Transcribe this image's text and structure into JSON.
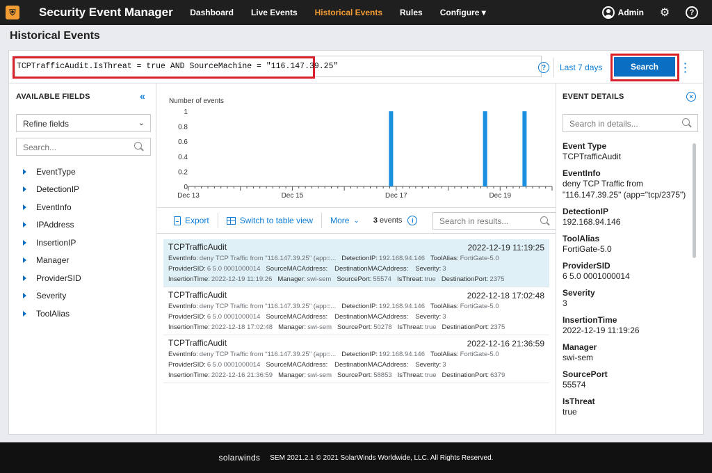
{
  "app": {
    "title": "Security Event Manager",
    "nav": [
      "Dashboard",
      "Live Events",
      "Historical Events",
      "Rules",
      "Configure ▾"
    ],
    "active_nav": "Historical Events",
    "user": "Admin",
    "help_glyph": "?"
  },
  "page": {
    "title": "Historical Events"
  },
  "search": {
    "query": "TCPTrafficAudit.IsThreat = true AND SourceMachine = \"116.147.39.25\"",
    "help_glyph": "?",
    "range": "Last 7 days",
    "button": "Search"
  },
  "fields_panel": {
    "heading": "AVAILABLE FIELDS",
    "refine_label": "Refine fields",
    "search_placeholder": "Search...",
    "fields": [
      "EventType",
      "DetectionIP",
      "EventInfo",
      "IPAddress",
      "InsertionIP",
      "Manager",
      "ProviderSID",
      "Severity",
      "ToolAlias"
    ]
  },
  "chart_data": {
    "type": "bar",
    "title": "",
    "ylabel": "Number of events",
    "ylim": [
      0,
      1
    ],
    "yticks": [
      "1",
      "0.8",
      "0.6",
      "0.4",
      "0.2",
      "0"
    ],
    "xticks": [
      "Dec 13",
      "Dec 15",
      "Dec 17",
      "Dec 19"
    ],
    "x_range_days": [
      13,
      20
    ],
    "bars": [
      {
        "x": "2022-12-16 21:36",
        "day": 16.9,
        "value": 1
      },
      {
        "x": "2022-12-18 17:02",
        "day": 18.71,
        "value": 1
      },
      {
        "x": "2022-12-19 11:19",
        "day": 19.47,
        "value": 1
      }
    ]
  },
  "toolbar": {
    "export": "Export",
    "switch_view": "Switch to table view",
    "more": "More",
    "count": "3",
    "count_label": "events",
    "info_glyph": "i",
    "results_placeholder": "Search in results..."
  },
  "events": [
    {
      "title": "TCPTrafficAudit",
      "time": "2022-12-19 11:19:25",
      "eventinfo": "deny TCP Traffic from \"116.147.39.25\" (app=...",
      "detection_ip": "192.168.94.146",
      "tool_alias": "FortiGate-5.0",
      "provider_sid": "6 5.0 0001000014",
      "severity": "3",
      "insertion_time": "2022-12-19 11:19:26",
      "manager": "swi-sem",
      "source_port": "55574",
      "is_threat": "true",
      "destination_port": "2375"
    },
    {
      "title": "TCPTrafficAudit",
      "time": "2022-12-18 17:02:48",
      "eventinfo": "deny TCP Traffic from \"116.147.39.25\" (app=...",
      "detection_ip": "192.168.94.146",
      "tool_alias": "FortiGate-5.0",
      "provider_sid": "6 5.0 0001000014",
      "severity": "3",
      "insertion_time": "2022-12-18 17:02:48",
      "manager": "swi-sem",
      "source_port": "50278",
      "is_threat": "true",
      "destination_port": "2375"
    },
    {
      "title": "TCPTrafficAudit",
      "time": "2022-12-16 21:36:59",
      "eventinfo": "deny TCP Traffic from \"116.147.39.25\" (app=...",
      "detection_ip": "192.168.94.146",
      "tool_alias": "FortiGate-5.0",
      "provider_sid": "6 5.0 0001000014",
      "severity": "3",
      "insertion_time": "2022-12-16 21:36:59",
      "manager": "swi-sem",
      "source_port": "58853",
      "is_threat": "true",
      "destination_port": "6379"
    }
  ],
  "event_labels": {
    "eventinfo": "EventInfo:",
    "detection_ip": "DetectionIP:",
    "tool_alias": "ToolAlias:",
    "provider_sid": "ProviderSID:",
    "source_mac": "SourceMACAddress:",
    "destination_mac": "DestinationMACAddress:",
    "severity": "Severity:",
    "insertion_time": "InsertionTime:",
    "manager": "Manager:",
    "source_port": "SourcePort:",
    "is_threat": "IsThreat:",
    "destination_port": "DestinationPort:"
  },
  "details_panel": {
    "heading": "EVENT DETAILS",
    "close_glyph": "×",
    "search_placeholder": "Search in details...",
    "items": [
      {
        "key": "Event Type",
        "value": "TCPTrafficAudit"
      },
      {
        "key": "EventInfo",
        "value": "deny TCP Traffic from \"116.147.39.25\" (app=\"tcp/2375\")"
      },
      {
        "key": "DetectionIP",
        "value": "192.168.94.146"
      },
      {
        "key": "ToolAlias",
        "value": "FortiGate-5.0"
      },
      {
        "key": "ProviderSID",
        "value": "6 5.0 0001000014"
      },
      {
        "key": "Severity",
        "value": "3"
      },
      {
        "key": "InsertionTime",
        "value": "2022-12-19 11:19:26"
      },
      {
        "key": "Manager",
        "value": "swi-sem"
      },
      {
        "key": "SourcePort",
        "value": "55574"
      },
      {
        "key": "IsThreat",
        "value": "true"
      }
    ]
  },
  "footer": {
    "brand": "solarwinds",
    "text": "SEM 2021.2.1 © 2021 SolarWinds Worldwide, LLC. All Rights Reserved."
  },
  "colors": {
    "accent": "#f39c34",
    "link": "#0a7bd6",
    "bar": "#1a8fe0",
    "highlight": "#d9212c",
    "selected_row": "#dff0f6"
  }
}
